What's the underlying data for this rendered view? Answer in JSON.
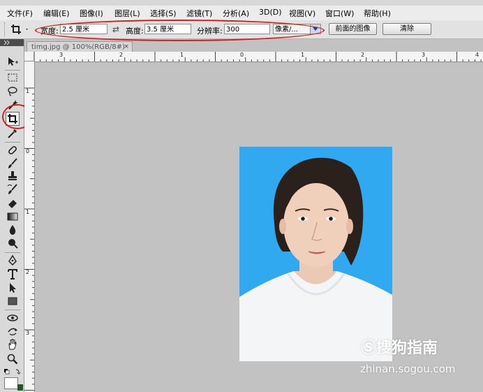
{
  "menubar": {
    "items": [
      {
        "label": "文件(F)"
      },
      {
        "label": "编辑(E)"
      },
      {
        "label": "图像(I)"
      },
      {
        "label": "图层(L)"
      },
      {
        "label": "选择(S)"
      },
      {
        "label": "滤镜(T)"
      },
      {
        "label": "分析(A)"
      },
      {
        "label": "3D(D)"
      },
      {
        "label": "视图(V)"
      },
      {
        "label": "窗口(W)"
      },
      {
        "label": "帮助(H)"
      }
    ]
  },
  "options": {
    "width_label": "宽度:",
    "width_value": "2.5 厘米",
    "swap_glyph": "⇄",
    "height_label": "高度:",
    "height_value": "3.5 厘米",
    "resolution_label": "分辨率:",
    "resolution_value": "300",
    "unit_value": "像素/...",
    "front_image_button": "前面的图像",
    "clear_button": "清除"
  },
  "document": {
    "tab_title": "timg.jpg @ 100%(RGB/8#)",
    "close_glyph": "×"
  },
  "ruler": {
    "h_labels": [
      "3",
      "2",
      "1",
      "0",
      "1",
      "2",
      "3",
      "4"
    ],
    "v_labels": [
      "1",
      "0",
      "1",
      "2",
      "3"
    ]
  },
  "watermark": {
    "logo_text": "Ⓢ搜狗指南",
    "url_text": "zhinan.sogou.com"
  },
  "colors": {
    "highlight_ring": "#d3211f",
    "photo_background": "#30a9f1"
  }
}
